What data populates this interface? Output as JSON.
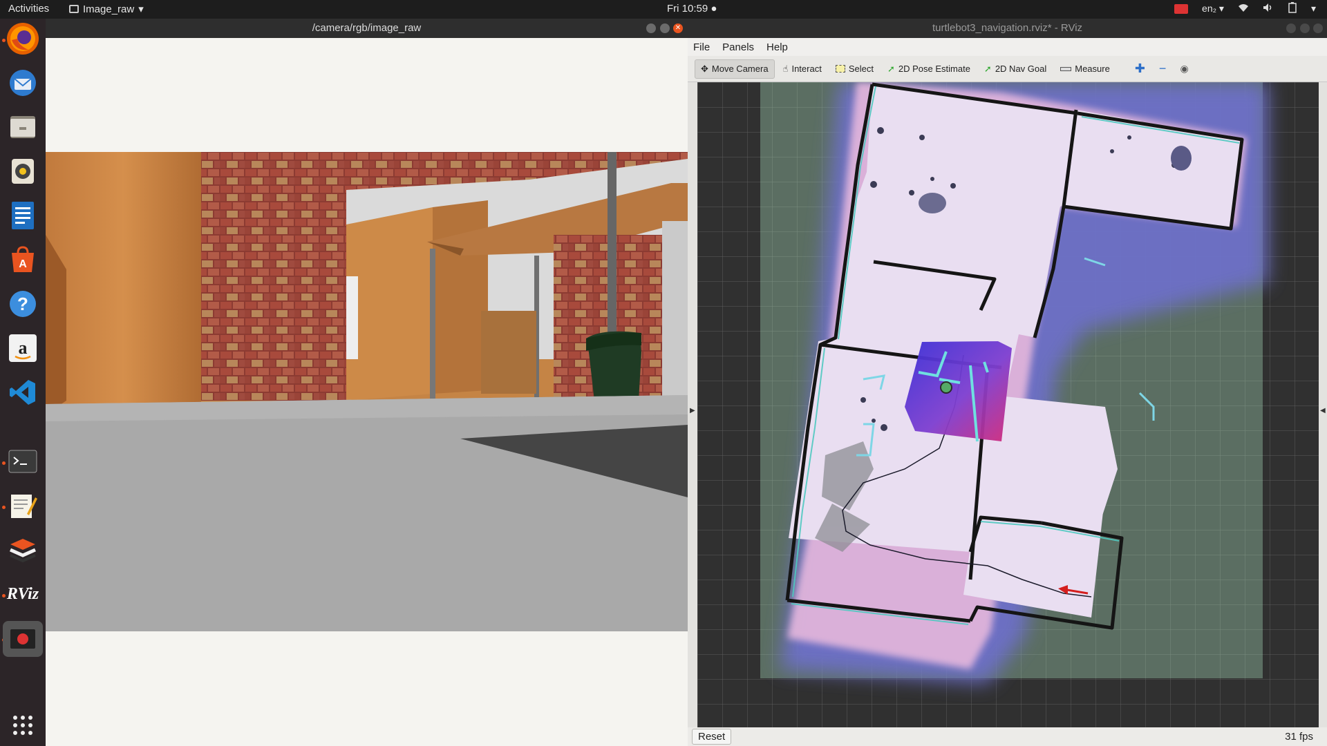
{
  "topbar": {
    "activities": "Activities",
    "app_name": "Image_raw",
    "clock": "Fri 10:59 ●",
    "lang": "en₂ ▾",
    "indicators": [
      "wifi-icon",
      "volume-icon",
      "battery-icon",
      "power-menu-icon"
    ]
  },
  "dock": {
    "items": [
      "Firefox",
      "Thunderbird",
      "Files",
      "Rhythmbox",
      "LibreOffice Writer",
      "Ubuntu Software",
      "Help",
      "Amazon",
      "Visual Studio Code",
      "Terminal",
      "Text Editor",
      "Books",
      "RViz",
      "Screen Recorder",
      "Show Applications"
    ]
  },
  "image_window": {
    "title": "/camera/rgb/image_raw"
  },
  "rviz": {
    "title": "turtlebot3_navigation.rviz* - RViz",
    "menu": [
      "File",
      "Panels",
      "Help"
    ],
    "tools": [
      "Move Camera",
      "Interact",
      "Select",
      "2D Pose Estimate",
      "2D Nav Goal",
      "Measure"
    ],
    "active_tool": "Move Camera",
    "reset_label": "Reset",
    "fps": "31 fps"
  },
  "colors": {
    "accent": "#e95420",
    "costmap_inflation": "#6d6fc8",
    "free_space": "#eadff0",
    "local_costmap": "#c4258c"
  }
}
